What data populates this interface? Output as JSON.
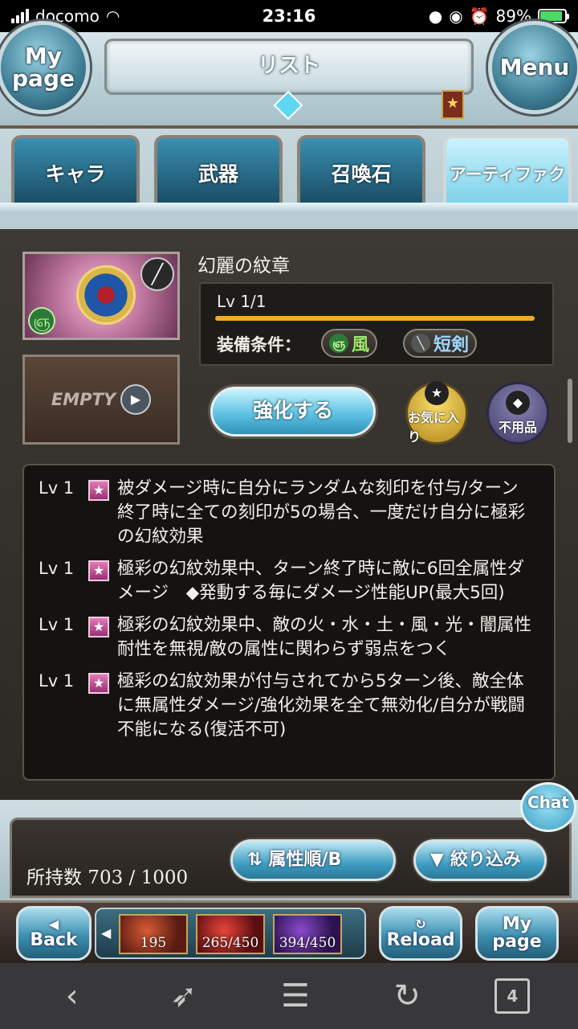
{
  "status_bar": {
    "carrier": "docomo",
    "time": "23:16",
    "battery": "89%",
    "battery_level": 0.89
  },
  "header": {
    "title": "リスト",
    "mypage_label_line1": "My",
    "mypage_label_line2": "page",
    "menu_label": "Menu"
  },
  "tabs": [
    {
      "label": "キャラ",
      "active": false
    },
    {
      "label": "武器",
      "active": false
    },
    {
      "label": "召喚石",
      "active": false
    },
    {
      "label": "アーティファクト",
      "active": true
    }
  ],
  "artifact": {
    "name": "幻麗の紋章",
    "level": "Lv 1/1",
    "level_fill": 1.0,
    "equip_label": "装備条件：",
    "element_tag": "風",
    "weapon_tag": "短剣",
    "empty_label": "EMPTY",
    "enhance_label": "強化する",
    "favorite_label": "お気に入り",
    "unused_label": "不用品"
  },
  "skills": [
    {
      "lv": "Lv 1",
      "text": "被ダメージ時に自分にランダムな刻印を付与/ターン終了時に全ての刻印が5の場合、一度だけ自分に極彩の幻紋効果"
    },
    {
      "lv": "Lv 1",
      "text": "極彩の幻紋効果中、ターン終了時に敵に6回全属性ダメージ　◆発動する毎にダメージ性能UP(最大5回)"
    },
    {
      "lv": "Lv 1",
      "text": "極彩の幻紋効果中、敵の火・水・土・風・光・闇属性耐性を無視/敵の属性に関わらず弱点をつく"
    },
    {
      "lv": "Lv 1",
      "text": "極彩の幻紋効果が付与されてから5ターン後、敵全体に無属性ダメージ/強化効果を全て無効化/自分が戦闘不能になる(復活不可)"
    }
  ],
  "footer": {
    "owned_label": "所持数 703 / 1000",
    "sort_label": "属性順/B",
    "filter_label": "絞り込み",
    "chat_label": "Chat"
  },
  "game_bar": {
    "back_label": "Back",
    "reload_label": "Reload",
    "mypage_line1": "My",
    "mypage_line2": "page",
    "gauges": [
      "195",
      "265/450",
      "394/450"
    ]
  },
  "browser_bar": {
    "tab_count": "4"
  },
  "colors": {
    "accent_blue": "#5fc3e4",
    "wind_green": "#2d7a38",
    "skill_pink": "#e27cb8",
    "level_bar": "#f4a92a"
  }
}
